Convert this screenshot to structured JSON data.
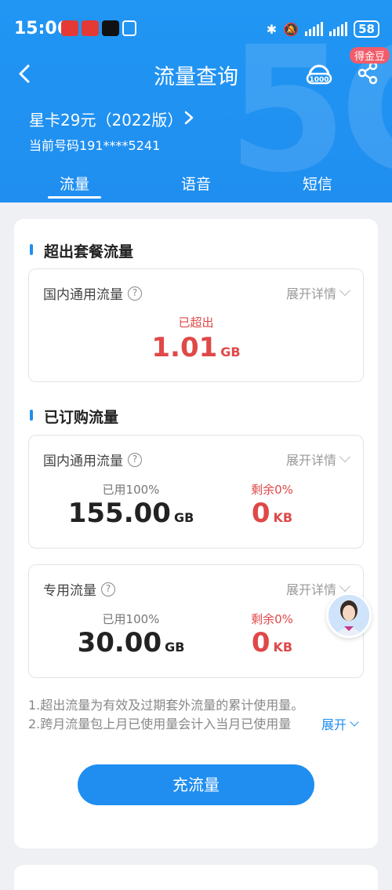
{
  "status_bar": {
    "time": "15:06",
    "battery": "58"
  },
  "nav": {
    "title": "流量查询",
    "bean_badge": "得金豆"
  },
  "plan": {
    "name": "星卡29元（2022版）",
    "phone": "当前号码191****5241"
  },
  "tabs": [
    {
      "label": "流量",
      "active": true
    },
    {
      "label": "语音",
      "active": false
    },
    {
      "label": "短信",
      "active": false
    }
  ],
  "exceeded": {
    "section_title": "超出套餐流量",
    "box_label": "国内通用流量",
    "expand_label": "展开详情",
    "status": "已超出",
    "value": "1.01",
    "unit": "GB"
  },
  "subscribed": {
    "section_title": "已订购流量",
    "items": [
      {
        "label": "国内通用流量",
        "expand_label": "展开详情",
        "used_label": "已用100%",
        "used_value": "155.00",
        "used_unit": "GB",
        "remain_label": "剩余0%",
        "remain_value": "0",
        "remain_unit": "KB"
      },
      {
        "label": "专用流量",
        "expand_label": "展开详情",
        "used_label": "已用100%",
        "used_value": "30.00",
        "used_unit": "GB",
        "remain_label": "剩余0%",
        "remain_value": "0",
        "remain_unit": "KB"
      }
    ]
  },
  "notes": {
    "line1": "1.超出流量为有效及过期套外流量的累计使用量。",
    "line2": "2.跨月流量包上月已使用量会计入当月已使用量",
    "expand": "展开"
  },
  "recharge_button": "充流量",
  "colors": {
    "brand_blue": "#1f8ef0",
    "alert_red": "#e04848"
  }
}
